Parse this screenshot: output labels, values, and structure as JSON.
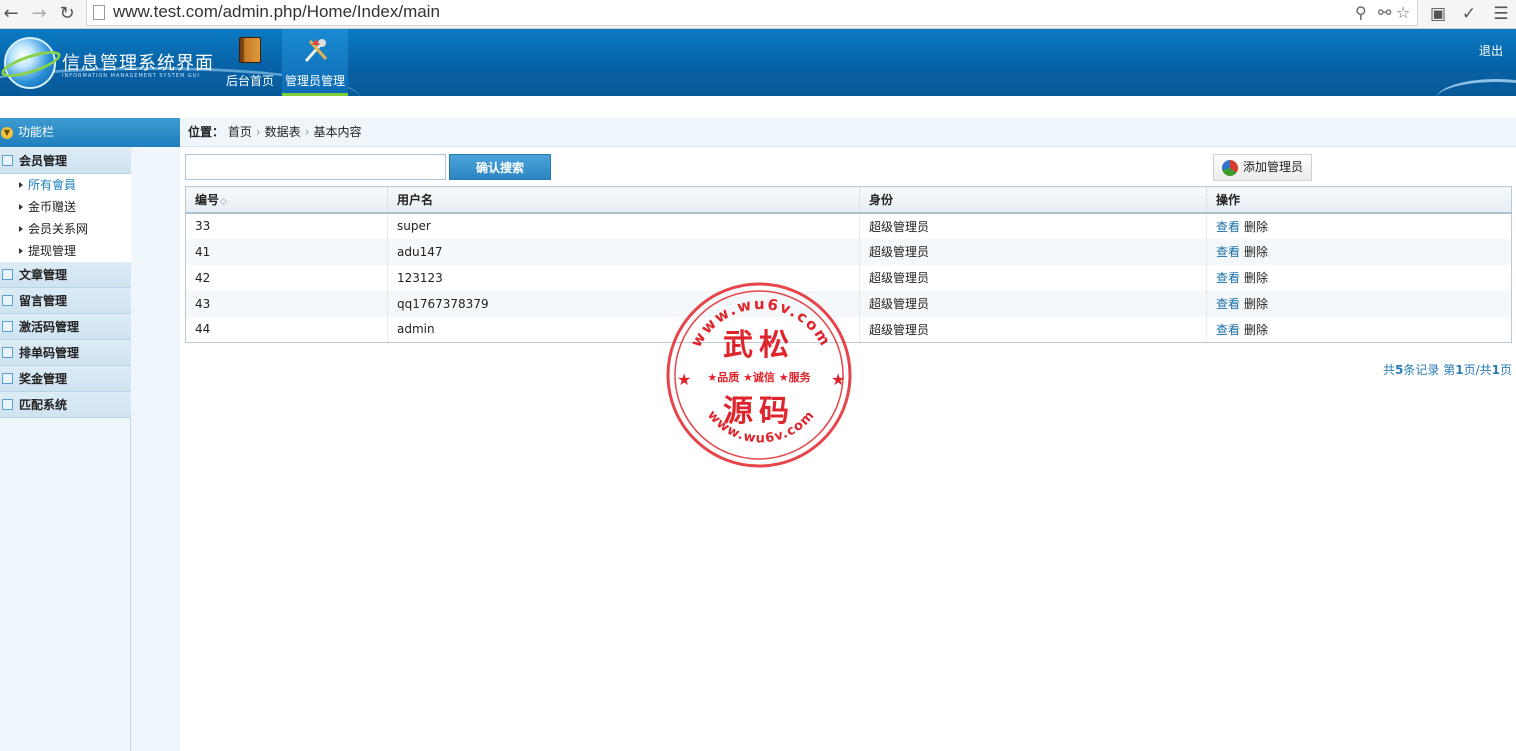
{
  "browser": {
    "url": "www.test.com/admin.php/Home/Index/main"
  },
  "header": {
    "title": "信息管理系统界面",
    "subtitle": "INFORMATION MANAGEMENT SYSTEM GUI",
    "nav": [
      {
        "label": "后台首页",
        "icon": "book-icon"
      },
      {
        "label": "管理员管理",
        "icon": "tools-icon"
      }
    ],
    "logout": "退出"
  },
  "sidebar": {
    "title": "功能栏",
    "groups": [
      {
        "label": "会员管理",
        "items": [
          "所有會員",
          "金币赠送",
          "会员关系网",
          "提现管理"
        ]
      },
      {
        "label": "文章管理"
      },
      {
        "label": "留言管理"
      },
      {
        "label": "激活码管理"
      },
      {
        "label": "排单码管理"
      },
      {
        "label": "奖金管理"
      },
      {
        "label": "匹配系统"
      }
    ]
  },
  "breadcrumb": {
    "label": "位置：",
    "items": [
      "首页",
      "数据表",
      "基本内容"
    ]
  },
  "search": {
    "value": "",
    "button": "确认搜索"
  },
  "add_button": "添加管理员",
  "table": {
    "columns": [
      "编号",
      "用户名",
      "身份",
      "操作"
    ],
    "rows": [
      {
        "id": "33",
        "username": "super",
        "role": "超级管理员",
        "view": "查看",
        "del": "删除"
      },
      {
        "id": "41",
        "username": "adu147",
        "role": "超级管理员",
        "view": "查看",
        "del": "删除"
      },
      {
        "id": "42",
        "username": "123123",
        "role": "超级管理员",
        "view": "查看",
        "del": "删除"
      },
      {
        "id": "43",
        "username": "qq1767378379",
        "role": "超级管理员",
        "view": "查看",
        "del": "删除"
      },
      {
        "id": "44",
        "username": "admin",
        "role": "超级管理员",
        "view": "查看",
        "del": "删除"
      }
    ]
  },
  "pager": {
    "prefix": "共",
    "total": "5",
    "mid": "条记录 第",
    "page": "1",
    "mid2": "页/共",
    "pages": "1",
    "suffix": "页"
  },
  "watermark": {
    "top_text": "www.wu6v.com",
    "line1": "武松",
    "middle": "★品质 ★诚信 ★服务",
    "line2": "源码",
    "bottom_text": "www.wu6v.com",
    "color": "#e0242c"
  },
  "colors": {
    "header_blue": "#0862a6",
    "accent_green": "#7fcf3a",
    "link_blue": "#1a6fa8"
  }
}
